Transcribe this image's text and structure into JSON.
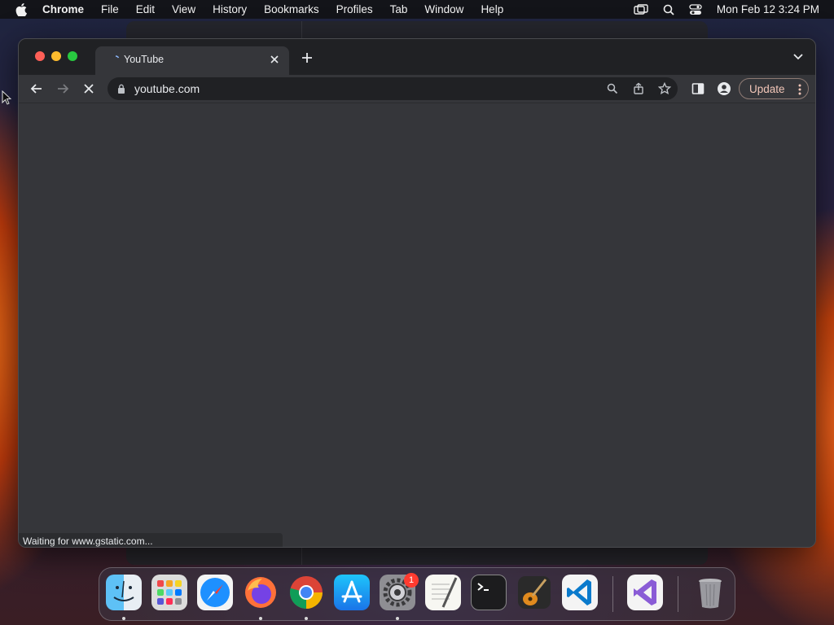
{
  "menubar": {
    "app": "Chrome",
    "items": [
      "File",
      "Edit",
      "View",
      "History",
      "Bookmarks",
      "Profiles",
      "Tab",
      "Window",
      "Help"
    ],
    "clock": "Mon Feb 12  3:24 PM"
  },
  "browser": {
    "tab": {
      "title": "YouTube"
    },
    "address": {
      "url": "youtube.com"
    },
    "update_label": "Update",
    "status_text": "Waiting for www.gstatic.com..."
  },
  "dock": {
    "apps": [
      "Finder",
      "Launchpad",
      "Safari",
      "Firefox",
      "Chrome",
      "App Store",
      "System Settings",
      "TextEdit",
      "Terminal",
      "GarageBand",
      "Visual Studio Code",
      "Visual Studio",
      "Trash"
    ],
    "settings_badge": "1"
  },
  "icons": {
    "apple": "apple-logo-icon",
    "screen-mirroring": "screen-mirroring-icon",
    "spotlight": "search-icon",
    "control-center": "control-center-icon",
    "back": "back-arrow-icon",
    "forward": "forward-arrow-icon",
    "stop": "stop-loading-icon",
    "lock": "lock-icon",
    "bookmark": "star-icon",
    "share": "share-icon"
  },
  "colors": {
    "chrome_frame": "#202124",
    "toolbar": "#35363a",
    "update_text": "#f2c6b8",
    "badge": "#ff3b30"
  }
}
